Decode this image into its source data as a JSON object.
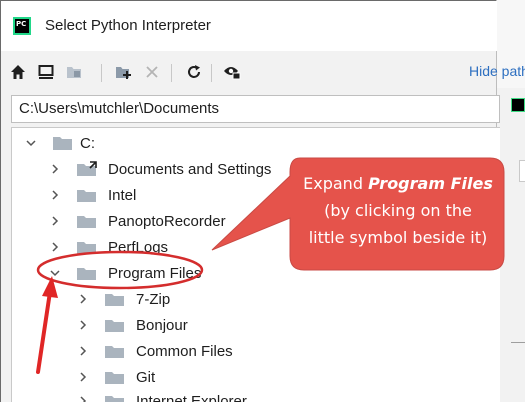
{
  "window": {
    "title": "Select Python Interpreter",
    "logo_text": "PC"
  },
  "toolbar": {
    "hide_path_label": "Hide path",
    "buttons": [
      {
        "name": "home-button",
        "icon": "home-icon"
      },
      {
        "name": "desktop-button",
        "icon": "desktop-icon"
      },
      {
        "name": "project-button",
        "icon": "project-folder-icon"
      },
      {
        "name": "new-folder-button",
        "icon": "new-folder-icon"
      },
      {
        "name": "delete-button",
        "icon": "close-icon"
      },
      {
        "name": "refresh-button",
        "icon": "refresh-icon"
      },
      {
        "name": "show-hidden-button",
        "icon": "eye-icon"
      }
    ]
  },
  "path": {
    "value": "C:\\Users\\mutchler\\Documents"
  },
  "tree": {
    "root": "C:",
    "items": [
      {
        "label": "Documents and Settings",
        "level": 1,
        "expanded": false,
        "shortcut": true
      },
      {
        "label": "Intel",
        "level": 1,
        "expanded": false
      },
      {
        "label": "PanoptoRecorder",
        "level": 1,
        "expanded": false
      },
      {
        "label": "PerfLogs",
        "level": 1,
        "expanded": false
      },
      {
        "label": "Program Files",
        "level": 1,
        "expanded": true
      },
      {
        "label": "7-Zip",
        "level": 2,
        "expanded": false
      },
      {
        "label": "Bonjour",
        "level": 2,
        "expanded": false
      },
      {
        "label": "Common Files",
        "level": 2,
        "expanded": false
      },
      {
        "label": "Git",
        "level": 2,
        "expanded": false
      },
      {
        "label": "Internet Explorer",
        "level": 2,
        "expanded": false
      }
    ]
  },
  "annotation": {
    "line1_prefix": "Expand ",
    "line1_emphasis": "Program Files",
    "line2": "(by clicking on the",
    "line3": "little symbol beside it)",
    "callout_color": "#e5534b",
    "arrow_color": "#e02626"
  }
}
